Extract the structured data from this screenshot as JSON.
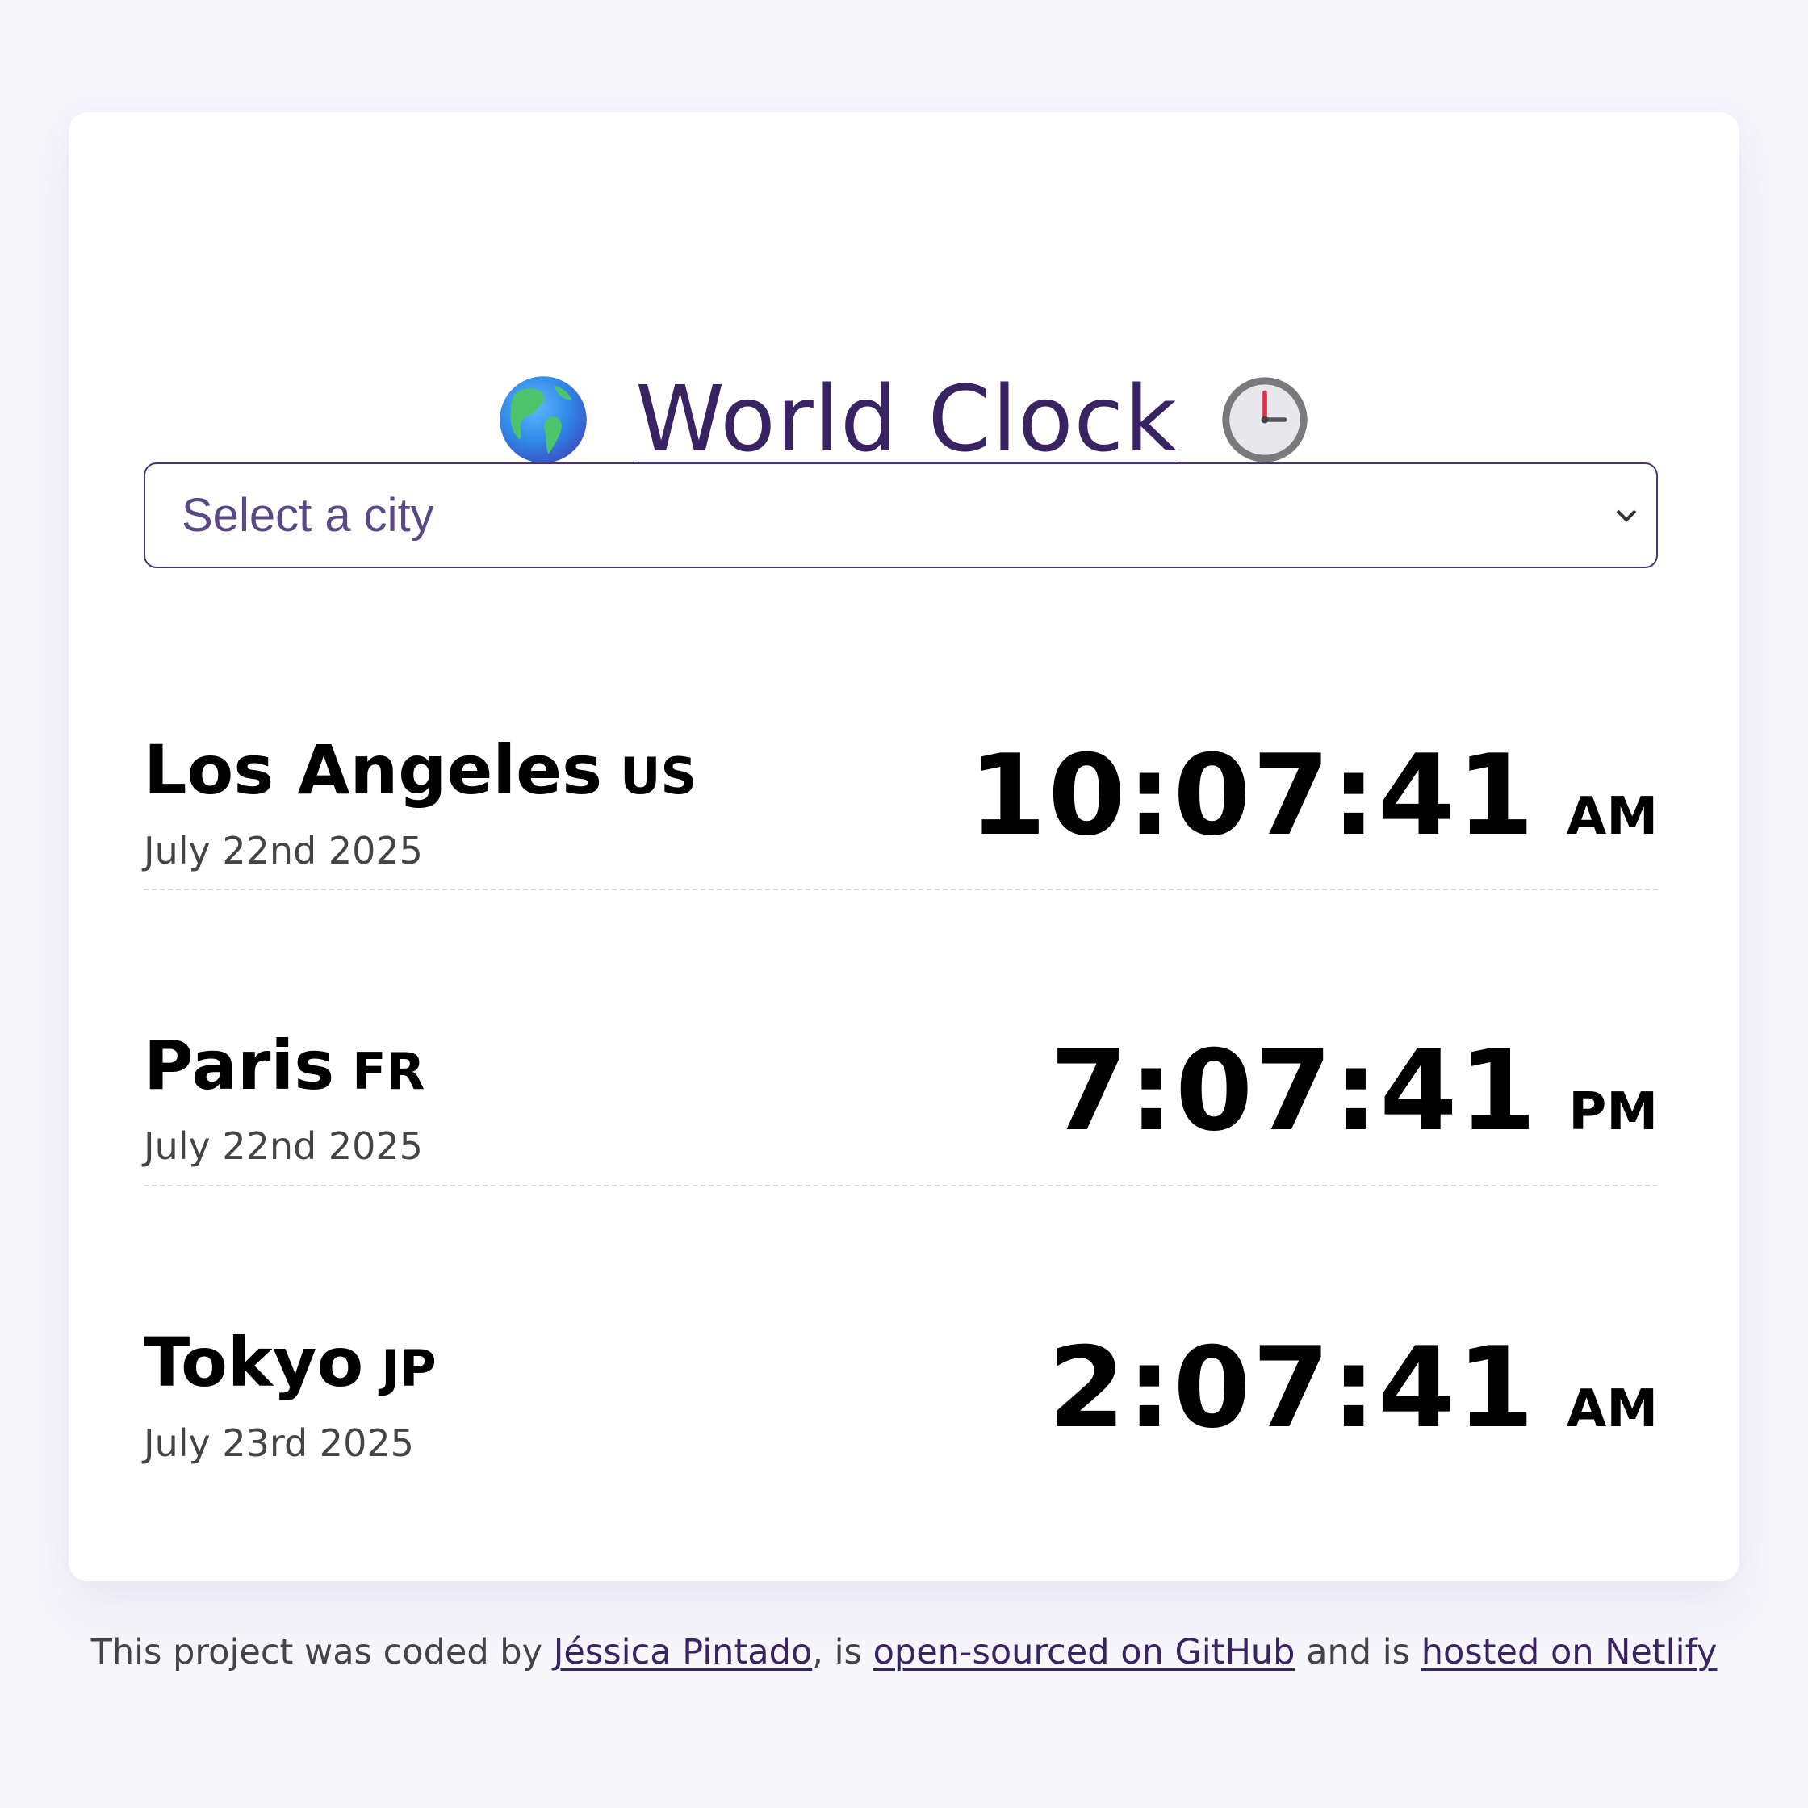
{
  "app": {
    "title": "World Clock",
    "icons": {
      "left": "globe-americas-icon",
      "right": "clock-three-oclock-icon"
    },
    "colors": {
      "background": "#f7f6fb",
      "card": "#ffffff",
      "accent": "#3a2363",
      "select_border": "#4a3479",
      "select_text": "#5b4986",
      "text_primary": "#000000",
      "text_secondary": "#444444"
    }
  },
  "city_select": {
    "placeholder": "Select a city"
  },
  "cities": [
    {
      "name": "Los Angeles",
      "country": "US",
      "date": "July 22nd 2025",
      "time": "10:07:41",
      "ampm": "AM"
    },
    {
      "name": "Paris",
      "country": "FR",
      "date": "July 22nd 2025",
      "time": "7:07:41",
      "ampm": "PM"
    },
    {
      "name": "Tokyo",
      "country": "JP",
      "date": "July 23rd 2025",
      "time": "2:07:41",
      "ampm": "AM"
    }
  ],
  "footer": {
    "prefix": "This project was coded by ",
    "author_link": "Jéssica Pintado",
    "middle1": ", is ",
    "github_link": "open-sourced on GitHub",
    "middle2": " and is ",
    "netlify_link": "hosted on Netlify"
  }
}
